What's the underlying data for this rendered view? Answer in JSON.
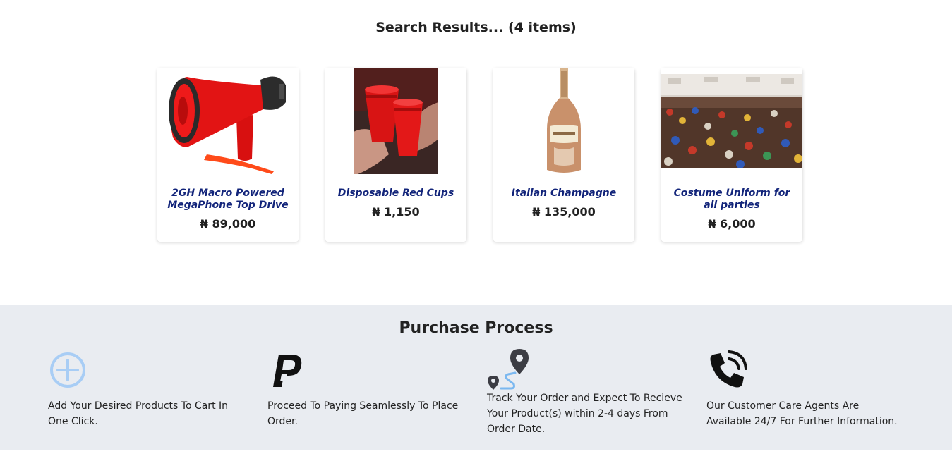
{
  "results": {
    "title": "Search Results... (4 items)"
  },
  "products": [
    {
      "name": "2GH Macro Powered MegaPhone Top Drive",
      "price": "₦ 89,000",
      "image": "red-megaphone"
    },
    {
      "name": "Disposable Red Cups",
      "price": "₦ 1,150",
      "image": "red-cups-toast"
    },
    {
      "name": "Italian Champagne",
      "price": "₦ 135,000",
      "image": "champagne-bottle"
    },
    {
      "name": "Costume Uniform for all parties",
      "price": "₦ 6,000",
      "image": "party-crowd"
    }
  ],
  "process": {
    "title": "Purchase Process",
    "steps": [
      {
        "icon": "plus-circle-icon",
        "text": "Add Your Desired Products To Cart In One Click."
      },
      {
        "icon": "paypal-icon",
        "text": "Proceed To Paying Seamlessly To Place Order."
      },
      {
        "icon": "route-pins-icon",
        "text": "Track Your Order and Expect To Recieve Your Product(s) within 2-4 days From Order Date."
      },
      {
        "icon": "phone-call-icon",
        "text": "Our Customer Care Agents Are Available 24/7 For Further Information."
      }
    ]
  },
  "colors": {
    "product_name": "#12247a",
    "process_bg": "#e9ecf1",
    "plus_icon": "#a8cdf5"
  }
}
